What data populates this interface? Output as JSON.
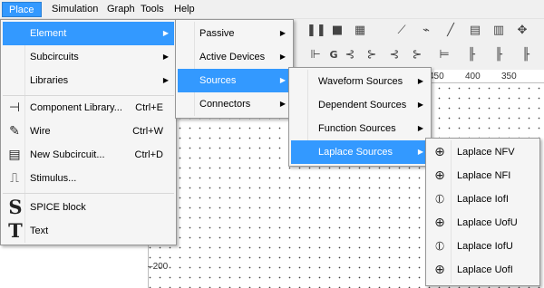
{
  "menubar": {
    "items": [
      "Place",
      "Simulation",
      "Graph",
      "Tools",
      "Help"
    ]
  },
  "rulers": {
    "top_ticks": [
      "450",
      "400",
      "350"
    ],
    "left_ticks": [
      "200"
    ]
  },
  "place_menu": {
    "items": [
      {
        "label": "Element",
        "shortcut": "",
        "icon": "none",
        "submenu": true
      },
      {
        "label": "Subcircuits",
        "shortcut": "",
        "icon": "none",
        "submenu": true
      },
      {
        "label": "Libraries",
        "shortcut": "",
        "icon": "none",
        "submenu": true
      },
      {
        "label": "Component Library...",
        "shortcut": "Ctrl+E",
        "icon": "component-library-icon",
        "submenu": false
      },
      {
        "label": "Wire",
        "shortcut": "Ctrl+W",
        "icon": "wire-pencil-icon",
        "submenu": false
      },
      {
        "label": "New Subcircuit...",
        "shortcut": "Ctrl+D",
        "icon": "subcircuit-icon",
        "submenu": false
      },
      {
        "label": "Stimulus...",
        "shortcut": "",
        "icon": "stimulus-icon",
        "submenu": false
      },
      {
        "label": "SPICE block",
        "shortcut": "",
        "icon": "spice-s-icon",
        "submenu": false
      },
      {
        "label": "Text",
        "shortcut": "",
        "icon": "text-t-icon",
        "submenu": false
      }
    ]
  },
  "element_menu": {
    "items": [
      {
        "label": "Passive"
      },
      {
        "label": "Active Devices"
      },
      {
        "label": "Sources"
      },
      {
        "label": "Connectors"
      }
    ]
  },
  "sources_menu": {
    "items": [
      {
        "label": "Waveform Sources"
      },
      {
        "label": "Dependent Sources"
      },
      {
        "label": "Function Sources"
      },
      {
        "label": "Laplace Sources"
      }
    ]
  },
  "laplace_menu": {
    "items": [
      {
        "label": "Laplace NFV",
        "icon": "laplace-source-icon"
      },
      {
        "label": "Laplace NFI",
        "icon": "laplace-source-icon"
      },
      {
        "label": "Laplace IofI",
        "icon": "laplace-current-source-icon"
      },
      {
        "label": "Laplace UofU",
        "icon": "laplace-source-icon"
      },
      {
        "label": "Laplace IofU",
        "icon": "laplace-current-source-icon"
      },
      {
        "label": "Laplace UofI",
        "icon": "laplace-source-icon"
      }
    ]
  },
  "colors": {
    "highlight": "#3399ff",
    "menu_bg": "#f5f5f5",
    "chrome": "#f0f0f0"
  }
}
